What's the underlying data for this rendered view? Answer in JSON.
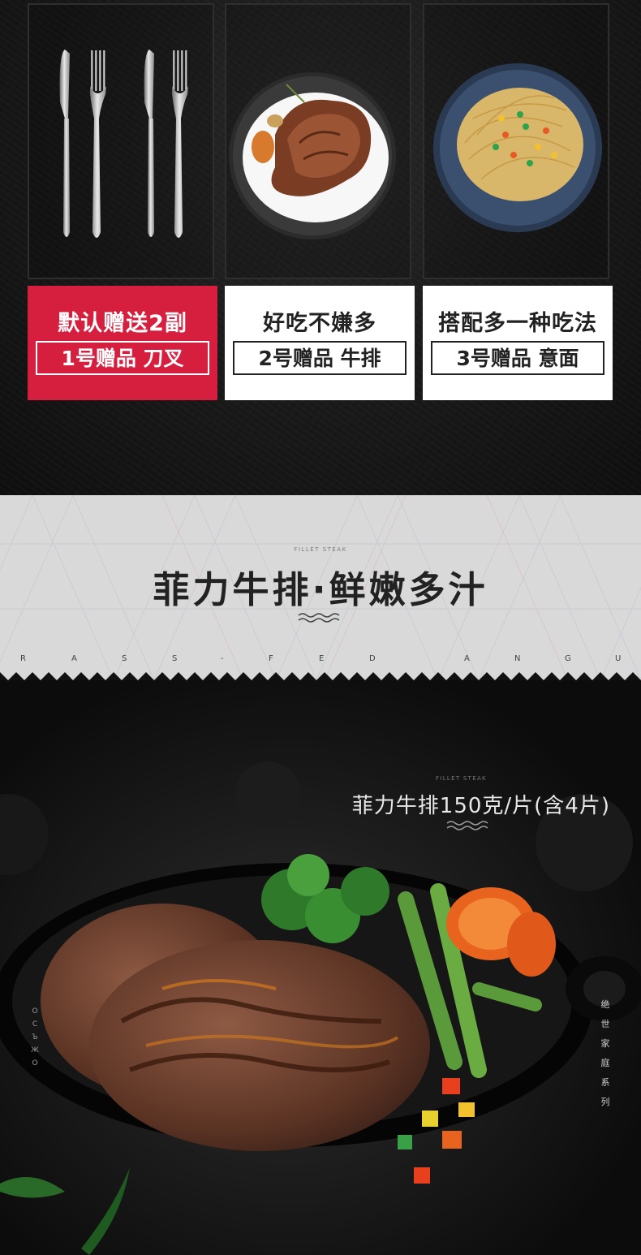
{
  "gifts": [
    {
      "slogan": "默认赠送2副",
      "tag": "1号赠品 刀叉",
      "image": "knife-and-fork"
    },
    {
      "slogan": "好吃不嫌多",
      "tag": "2号赠品 牛排",
      "image": "steak-plate"
    },
    {
      "slogan": "搭配多一种吃法",
      "tag": "3号赠品 意面",
      "image": "spaghetti-plate"
    }
  ],
  "banner": {
    "eng_small": "FILLET STEAK",
    "title": "菲力牛排·鲜嫩多汁",
    "letters": [
      "R",
      "A",
      "S",
      "S",
      "-",
      "F",
      "E",
      "D",
      "A",
      "N",
      "G",
      "U"
    ]
  },
  "product": {
    "eng_small": "FILLET STEAK",
    "desc": "菲力牛排150克/片(含4片)",
    "side_text": [
      "绝",
      "世",
      "家",
      "庭",
      "系",
      "列"
    ],
    "left_marks": [
      "Ο",
      "C",
      "Ъ",
      "Ж",
      "Ο"
    ]
  },
  "colors": {
    "accent_red": "#d61f3e",
    "banner_bg": "#d9d9d9",
    "dark_bg": "#141414"
  }
}
